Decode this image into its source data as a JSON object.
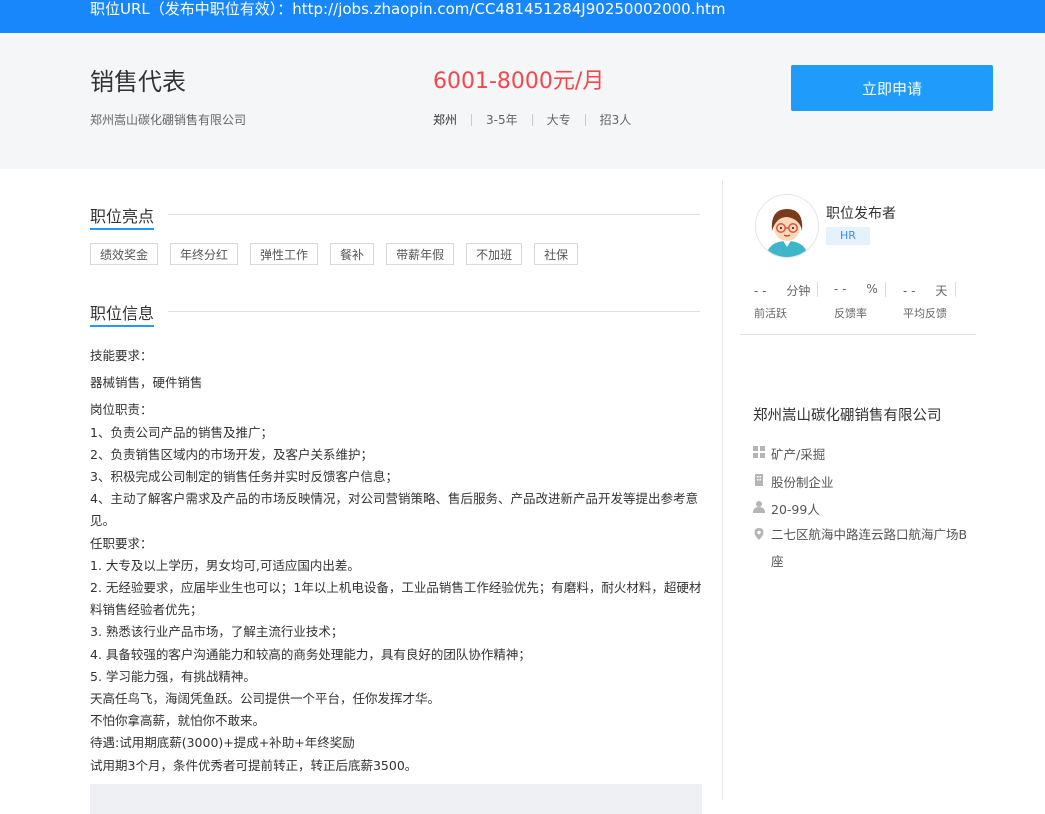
{
  "topbar": {
    "url_text": "职位URL（发布中职位有效）：http://jobs.zhaopin.com/CC481451284J90250002000.htm"
  },
  "job": {
    "title": "销售代表",
    "company": "郑州嵩山碳化硼销售有限公司",
    "salary": "6001-8000元/月",
    "city": "郑州",
    "experience": "3-5年",
    "education": "大专",
    "headcount": "招3人",
    "apply_label": "立即申请"
  },
  "highlights": {
    "title": "职位亮点",
    "tags": [
      "绩效奖金",
      "年终分红",
      "弹性工作",
      "餐补",
      "带薪年假",
      "不加班",
      "社保"
    ]
  },
  "info": {
    "title": "职位信息",
    "lines": [
      "技能要求：",
      "器械销售，硬件销售",
      "岗位职责：",
      "1、负责公司产品的销售及推广；",
      "2、负责销售区域内的市场开发，及客户关系维护；",
      "3、积极完成公司制定的销售任务并实时反馈客户信息；",
      "4、主动了解客户需求及产品的市场反映情况，对公司营销策略、售后服务、产品改进新产品开发等提出参考意见。",
      "任职要求：",
      "1. 大专及以上学历，男女均可,可适应国内出差。",
      "2. 无经验要求，应届毕业生也可以；1年以上机电设备，工业品销售工作经验优先；有磨料，耐火材料，超硬材料销售经验者优先；",
      "3. 熟悉该行业产品市场，了解主流行业技术；",
      "4. 具备较强的客户沟通能力和较高的商务处理能力，具有良好的团队协作精神；",
      "5. 学习能力强，有挑战精神。",
      "天高任鸟飞，海阔凭鱼跃。公司提供一个平台，任你发挥才华。",
      "不怕你拿高薪，就怕你不敢来。",
      "待遇:试用期底薪(3000)+提成+补助+年终奖励",
      "试用期3个月，条件优秀者可提前转正，转正后底薪3500。"
    ]
  },
  "publisher": {
    "label": "职位发布者",
    "role": "HR",
    "stats": [
      {
        "value": "- -",
        "unit": "分钟",
        "label": "前活跃"
      },
      {
        "value": "- -",
        "unit": "%",
        "label": "反馈率"
      },
      {
        "value": "- -",
        "unit": "天",
        "label": "平均反馈"
      }
    ]
  },
  "company": {
    "name": "郑州嵩山碳化硼销售有限公司",
    "industry": "矿产/采掘",
    "type": "股份制企业",
    "size": "20-99人",
    "address": "二七区航海中路连云路口航海广场B座"
  },
  "colors": {
    "primary": "#1787fb",
    "salary": "#f5474b",
    "button": "#1e9bfb"
  }
}
